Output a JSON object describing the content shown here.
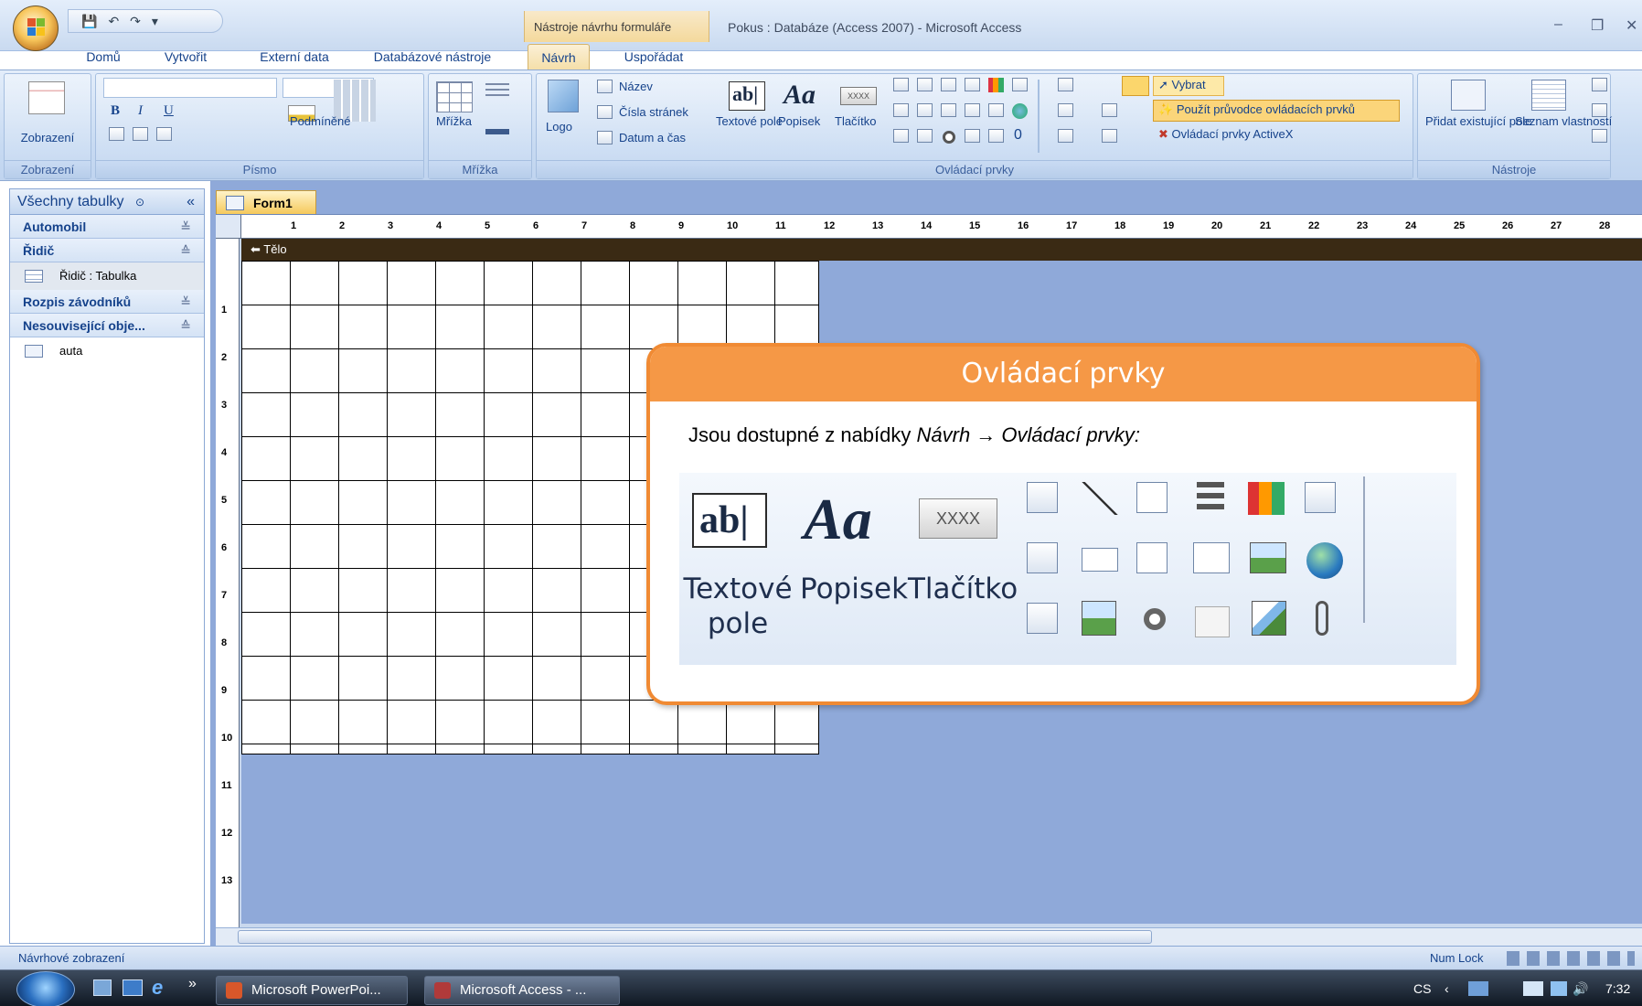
{
  "window": {
    "context_tab_title": "Nástroje návrhu formuláře",
    "title": "Pokus : Databáze (Access 2007) - Microsoft Access",
    "minimize": "–",
    "restore": "❐",
    "close": "✕"
  },
  "qat": {
    "dropdown": "▾"
  },
  "tabs": [
    {
      "label": "Domů"
    },
    {
      "label": "Vytvořit"
    },
    {
      "label": "Externí data"
    },
    {
      "label": "Databázové nástroje"
    },
    {
      "label": "Návrh"
    },
    {
      "label": "Uspořádat"
    }
  ],
  "ribbon": {
    "view_group": {
      "button": "Zobrazení",
      "label": "Zobrazení"
    },
    "font_group": {
      "label": "Písmo",
      "conditional": "Podmíněné"
    },
    "grid_group": {
      "button": "Mřížka",
      "label": "Mřížka"
    },
    "controls_group": {
      "logo": "Logo",
      "title": "Název",
      "page_numbers": "Čísla stránek",
      "date_time": "Datum a čas",
      "textbox": "Textové pole",
      "label_ctrl": "Popisek",
      "button_ctrl": "Tlačítko",
      "select": "Vybrat",
      "wizard": "Použít průvodce ovládacích prvků",
      "activex": "Ovládací prvky ActiveX",
      "label": "Ovládací prvky"
    },
    "tools_group": {
      "add_field": "Přidat existující pole",
      "props": "Seznam vlastností",
      "label": "Nástroje"
    }
  },
  "nav": {
    "header": "Všechny tabulky",
    "collapse": "«",
    "groups": [
      {
        "label": "Automobil",
        "chev": "≚"
      },
      {
        "label": "Řidič",
        "chev": "≙"
      },
      {
        "label": "Rozpis závodníků",
        "chev": "≚"
      },
      {
        "label": "Nesouvisející obje...",
        "chev": "≙"
      }
    ],
    "items": [
      {
        "label": "Řidič : Tabulka"
      },
      {
        "label": "auta"
      }
    ]
  },
  "document": {
    "tab": "Form1",
    "section": "Tělo",
    "ruler_top": [
      "1",
      "2",
      "3",
      "4",
      "5",
      "6",
      "7",
      "8",
      "9",
      "10",
      "11",
      "12",
      "13",
      "14",
      "15",
      "16",
      "17",
      "18",
      "19",
      "20",
      "21",
      "22",
      "23",
      "24",
      "25",
      "26",
      "27",
      "28"
    ],
    "ruler_left": [
      "1",
      "2",
      "3",
      "4",
      "5",
      "6",
      "7",
      "8",
      "9",
      "10",
      "11",
      "12",
      "13"
    ]
  },
  "callout": {
    "title": "Ovládací prvky",
    "text_plain": "Jsou dostupné z nabídky ",
    "text_em": "Návrh → Ovládací prvky:",
    "textbox": "Textové pole",
    "label_ctrl": "Popisek",
    "button_ctrl": "Tlačítko",
    "button_glyph": "XXXX",
    "textbox_glyph": "ab|",
    "label_glyph": "Aa"
  },
  "status": {
    "left": "Návrhové zobrazení",
    "numlock": "Num Lock"
  },
  "taskbar": {
    "chevron": "»",
    "apps": [
      {
        "label": "Microsoft PowerPoi..."
      },
      {
        "label": "Microsoft Access - ..."
      }
    ],
    "lang": "CS",
    "clock": "7:32"
  }
}
